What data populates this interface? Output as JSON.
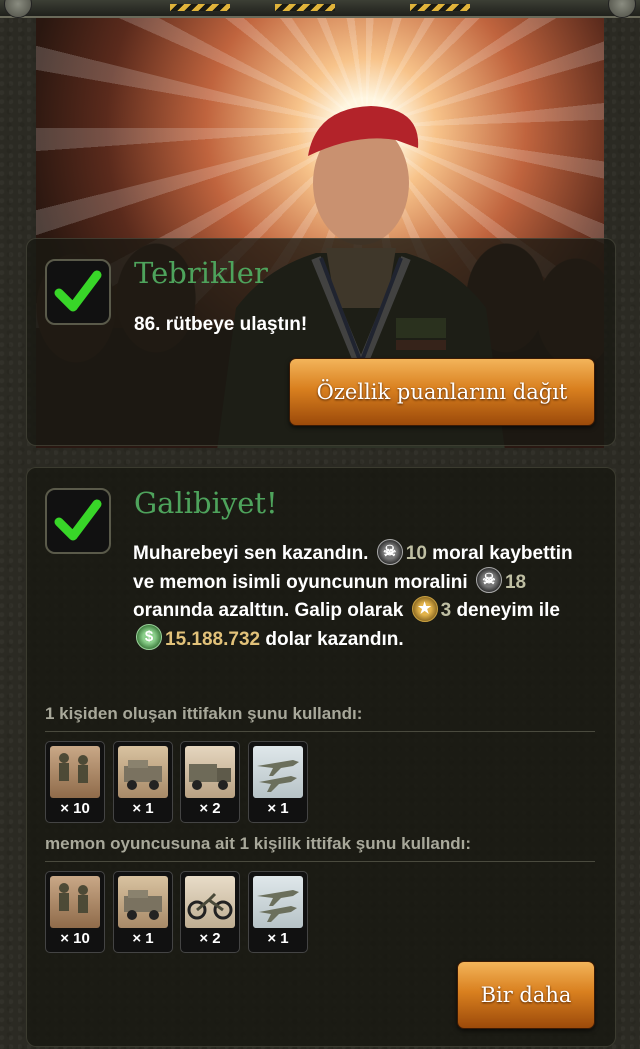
{
  "congrats": {
    "title": "Tebrikler",
    "message": "86. rütbeye ulaştın!",
    "button_label": "Özellik puanlarını dağıt"
  },
  "victory": {
    "title": "Galibiyet!",
    "text": {
      "p1": "Muharebeyi sen kazandın.",
      "morale_lost": "10",
      "p2": "moral kaybettin ve memon isimli oyuncunun moralini",
      "morale_reduced": "18",
      "p3": "oranında azalttın. Galip olarak",
      "xp": "3",
      "p4": "deneyim ile",
      "dollars": "15.188.732",
      "p5": "dolar kazandın."
    }
  },
  "own_alliance": {
    "label": "1 kişiden oluşan ittifakın şunu kullandı:",
    "units": [
      {
        "icon": "infantry-icon",
        "count": "× 10"
      },
      {
        "icon": "armored-truck-icon",
        "count": "× 1"
      },
      {
        "icon": "military-truck-icon",
        "count": "× 2"
      },
      {
        "icon": "fighter-jet-icon",
        "count": "× 1"
      }
    ]
  },
  "enemy_alliance": {
    "label": "memon oyuncusuna ait 1 kişilik ittifak şunu kullandı:",
    "units": [
      {
        "icon": "infantry-icon",
        "count": "× 10"
      },
      {
        "icon": "armored-truck-icon",
        "count": "× 1"
      },
      {
        "icon": "motorcycle-icon",
        "count": "× 2"
      },
      {
        "icon": "fighter-jet-icon",
        "count": "× 1"
      }
    ]
  },
  "again_button_label": "Bir daha",
  "colors": {
    "title_green": "#4ea35c",
    "button_orange": "#d9801f",
    "money_gold": "#e2c27a"
  }
}
